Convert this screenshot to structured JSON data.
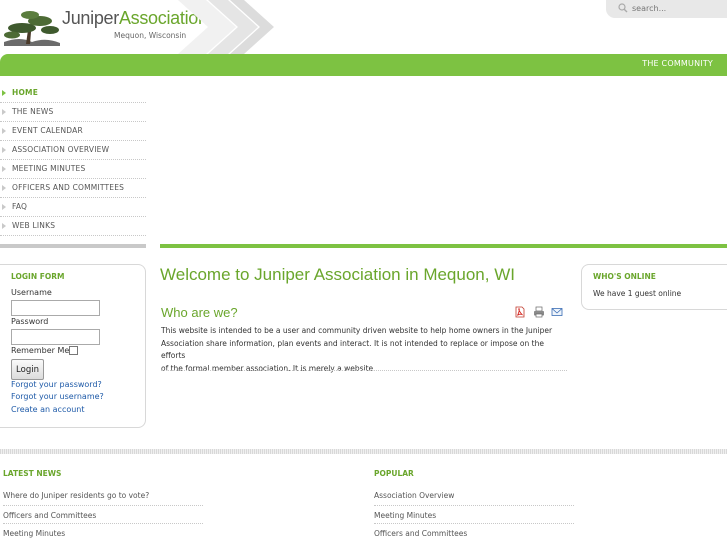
{
  "header": {
    "brand_name": "Juniper",
    "brand_accent": "Association",
    "brand_subtitle": "Mequon, Wisconsin",
    "search_placeholder": "search..."
  },
  "topnav": {
    "link": "THE COMMUNITY"
  },
  "sidebar": {
    "items": [
      {
        "label": "HOME",
        "active": true
      },
      {
        "label": "THE NEWS"
      },
      {
        "label": "EVENT CALENDAR"
      },
      {
        "label": "ASSOCIATION OVERVIEW"
      },
      {
        "label": "MEETING MINUTES"
      },
      {
        "label": "OFFICERS AND COMMITTEES"
      },
      {
        "label": "FAQ"
      },
      {
        "label": "WEB LINKS"
      }
    ]
  },
  "login": {
    "heading": "LOGIN FORM",
    "username_label": "Username",
    "username_value": "",
    "password_label": "Password",
    "password_value": "",
    "remember_label": "Remember Me",
    "button_label": "Login",
    "forgot_password": "Forgot your password?",
    "forgot_username": "Forgot your username?",
    "create_account": "Create an account"
  },
  "main": {
    "title": "Welcome to Juniper Association in Mequon, WI",
    "article_title": "Who are we?",
    "article_icons": [
      "pdf-icon",
      "print-icon",
      "email-icon"
    ],
    "article_lines": [
      "This website is intended to be a user and community driven website to help home owners in the Juniper",
      "Association share information, plan events and interact.   It is not intended to replace or impose on the efforts",
      "of the formal member association.  It is merely a website."
    ]
  },
  "online": {
    "heading": "WHO'S ONLINE",
    "text": "We have 1 guest online"
  },
  "footer": {
    "latest": {
      "heading": "LATEST NEWS",
      "items": [
        "Where do Juniper residents go to vote?",
        "Officers and Committees",
        "Meeting Minutes"
      ]
    },
    "popular": {
      "heading": "POPULAR",
      "items": [
        "Association Overview",
        "Meeting Minutes",
        "Officers and Committees"
      ]
    }
  },
  "colors": {
    "accent_green": "#7dc242",
    "heading_green": "#6aa62c",
    "link_blue": "#1e5aa8"
  }
}
